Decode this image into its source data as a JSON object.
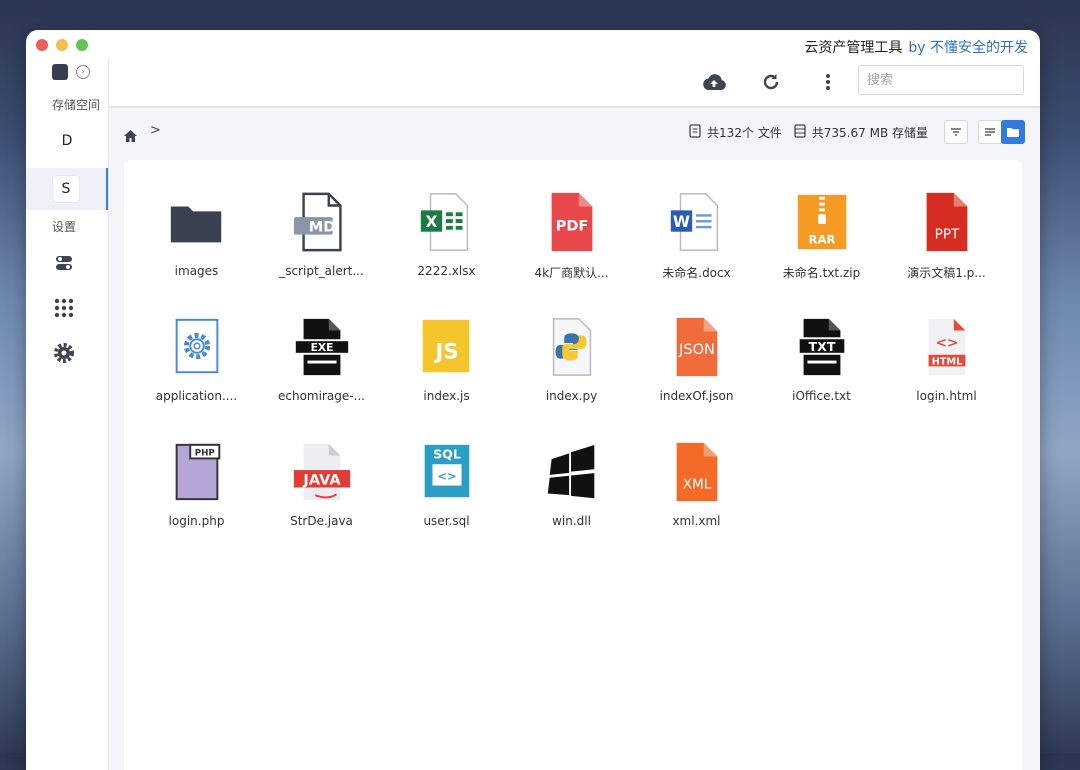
{
  "window": {
    "title": "云资产管理工具",
    "title_by": "by 不懂安全的开发",
    "lights": {
      "close": "#ed5e58",
      "minimize": "#f5be4f",
      "maximize": "#61c455"
    }
  },
  "sidebar": {
    "section_storage": "存储空间",
    "items": [
      {
        "label": "D"
      },
      {
        "label": "S",
        "active": true
      }
    ],
    "section_settings": "设置",
    "icons": [
      "toggle-icon",
      "apps-grid-icon",
      "settings-gear-icon"
    ]
  },
  "toolbar": {
    "upload_icon": "cloud-upload-icon",
    "refresh_icon": "refresh-icon",
    "more_icon": "more-vertical-icon",
    "search_placeholder": "搜索"
  },
  "pathbar": {
    "home_icon": "home-icon",
    "separator": ">",
    "file_count": "共132个 文件",
    "storage_total": "共735.67 MB 存储量"
  },
  "files": [
    {
      "name": "images",
      "type": "folder"
    },
    {
      "name": "_script_alert...",
      "type": "md"
    },
    {
      "name": "2222.xlsx",
      "type": "xlsx"
    },
    {
      "name": "4k厂商默认...",
      "type": "pdf"
    },
    {
      "name": "未命名.docx",
      "type": "docx"
    },
    {
      "name": "未命名.txt.zip",
      "type": "rar"
    },
    {
      "name": "演示文稿1.p...",
      "type": "ppt"
    },
    {
      "name": "application....",
      "type": "config"
    },
    {
      "name": "echomirage-...",
      "type": "exe"
    },
    {
      "name": "index.js",
      "type": "js"
    },
    {
      "name": "index.py",
      "type": "py"
    },
    {
      "name": "indexOf.json",
      "type": "json"
    },
    {
      "name": "iOffice.txt",
      "type": "txt"
    },
    {
      "name": "login.html",
      "type": "html"
    },
    {
      "name": "login.php",
      "type": "php"
    },
    {
      "name": "StrDe.java",
      "type": "java"
    },
    {
      "name": "user.sql",
      "type": "sql"
    },
    {
      "name": "win.dll",
      "type": "dll"
    },
    {
      "name": "xml.xml",
      "type": "xml"
    }
  ],
  "icon_labels": {
    "md": "MD",
    "xlsx": "X",
    "pdf": "PDF",
    "docx": "W",
    "rar": "RAR",
    "ppt": "PPT",
    "exe": "EXE",
    "js": "JS",
    "json": "JSON",
    "txt": "TXT",
    "html": "HTML",
    "php": "PHP",
    "php_sym": "<?>",
    "java": "JAVA",
    "sql": "SQL",
    "xml": "XML"
  }
}
